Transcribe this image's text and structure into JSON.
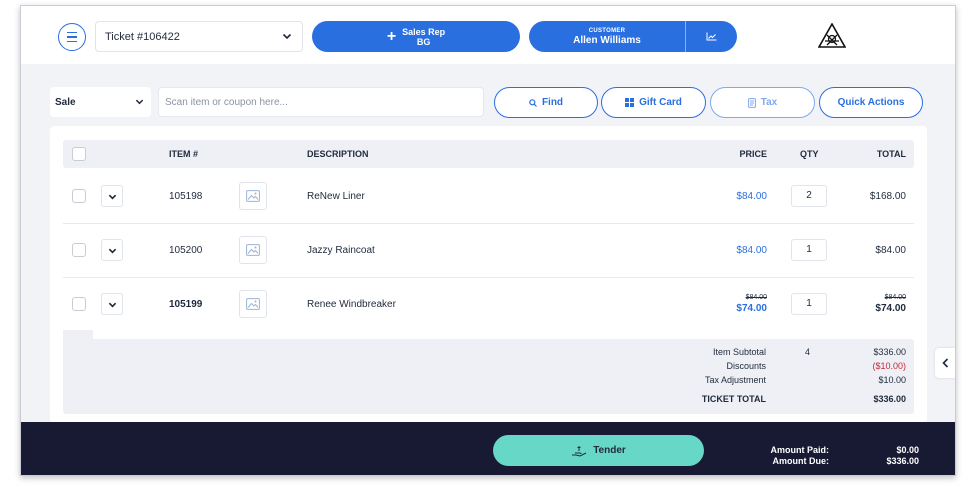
{
  "header": {
    "ticket_select_value": "Ticket #106422",
    "sales_rep_label": "Sales Rep",
    "sales_rep_initials": "BG",
    "customer_label": "CUSTOMER",
    "customer_name": "Allen Williams"
  },
  "toolbar": {
    "sale_type_value": "Sale",
    "scan_placeholder": "Scan item or coupon here...",
    "find_label": "Find",
    "gift_card_label": "Gift Card",
    "tax_label": "Tax",
    "quick_actions_label": "Quick Actions"
  },
  "table": {
    "columns": {
      "item": "ITEM #",
      "description": "DESCRIPTION",
      "price": "PRICE",
      "qty": "QTY",
      "total": "TOTAL"
    },
    "rows": [
      {
        "item": "105198",
        "description": "ReNew Liner",
        "price": "$84.00",
        "qty": "2",
        "total": "$168.00"
      },
      {
        "item": "105200",
        "description": "Jazzy Raincoat",
        "price": "$84.00",
        "qty": "1",
        "total": "$84.00"
      },
      {
        "item": "105199",
        "description": "Renee Windbreaker",
        "original_price": "$84.00",
        "price": "$74.00",
        "qty": "1",
        "original_total": "$84.00",
        "total": "$74.00"
      }
    ]
  },
  "summary": {
    "item_subtotal_label": "Item Subtotal",
    "item_subtotal_qty": "4",
    "item_subtotal_value": "$336.00",
    "discounts_label": "Discounts",
    "discounts_value": "($10.00)",
    "tax_adjustment_label": "Tax Adjustment",
    "tax_adjustment_value": "$10.00",
    "ticket_total_label": "TICKET TOTAL",
    "ticket_total_value": "$336.00"
  },
  "footer": {
    "tender_label": "Tender",
    "amount_paid_label": "Amount Paid:",
    "amount_paid_value": "$0.00",
    "amount_due_label": "Amount Due:",
    "amount_due_value": "$336.00"
  },
  "colors": {
    "accent": "#2a6fe0",
    "tender": "#67d7c8",
    "footer_bg": "#181a33",
    "discount": "#c6283b"
  },
  "icons": [
    "menu-icon",
    "chevron-down-icon",
    "plus-icon",
    "chart-icon",
    "store-logo",
    "search-icon",
    "grid-icon",
    "receipt-icon",
    "image-placeholder-icon",
    "chevron-left-icon",
    "hand-cash-icon"
  ]
}
